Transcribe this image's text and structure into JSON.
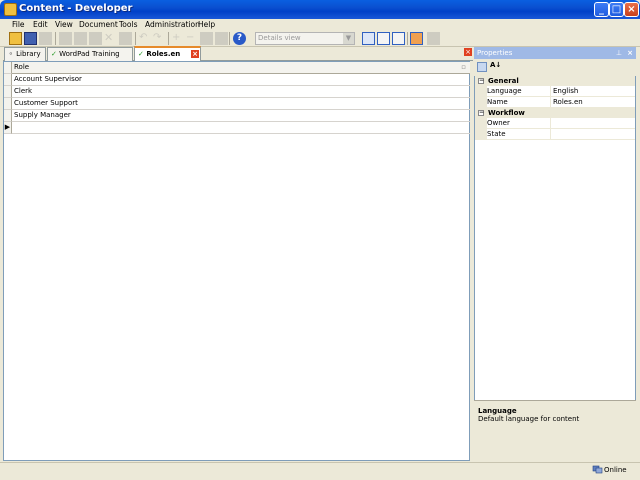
{
  "window": {
    "title": "Content - Developer"
  },
  "menu": [
    "File",
    "Edit",
    "View",
    "Document",
    "Tools",
    "Administration",
    "Help"
  ],
  "toolbar": {
    "view_select": "Details view"
  },
  "tabs": [
    {
      "label": "Library"
    },
    {
      "label": "WordPad Training"
    },
    {
      "label": "Roles.en",
      "active": true
    }
  ],
  "grid": {
    "header": "Role",
    "rows": [
      "Account Supervisor",
      "Clerk",
      "Customer Support",
      "Supply Manager"
    ]
  },
  "properties": {
    "title": "Properties",
    "categories": [
      {
        "name": "General",
        "rows": [
          {
            "name": "Language",
            "value": "English"
          },
          {
            "name": "Name",
            "value": "Roles.en"
          }
        ]
      },
      {
        "name": "Workflow",
        "rows": [
          {
            "name": "Owner",
            "value": ""
          },
          {
            "name": "State",
            "value": ""
          }
        ]
      }
    ],
    "description": {
      "title": "Language",
      "text": "Default language for content"
    }
  },
  "status": {
    "text": "Online"
  },
  "colors": {
    "titlebar": "#0a4fd0",
    "active_tab_accent": "#e68b2c",
    "grid_border": "#7f9db9"
  }
}
